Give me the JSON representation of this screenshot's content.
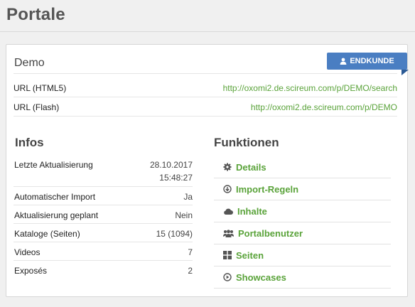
{
  "page": {
    "title": "Portale"
  },
  "card": {
    "title": "Demo",
    "badge": {
      "label": "ENDKUNDE",
      "icon": "user-icon"
    },
    "urls": [
      {
        "label": "URL (HTML5)",
        "value": "http://oxomi2.de.scireum.com/p/DEMO/search"
      },
      {
        "label": "URL (Flash)",
        "value": "http://oxomi2.de.scireum.com/p/DEMO"
      }
    ]
  },
  "infos": {
    "title": "Infos",
    "rows": [
      {
        "label": "Letzte Aktualisierung",
        "value_line1": "28.10.2017",
        "value_line2": "15:48:27"
      },
      {
        "label": "Automatischer Import",
        "value": "Ja"
      },
      {
        "label": "Aktualisierung geplant",
        "value": "Nein"
      },
      {
        "label": "Kataloge (Seiten)",
        "value": "15 (1094)"
      },
      {
        "label": "Videos",
        "value": "7"
      },
      {
        "label": "Exposés",
        "value": "2"
      }
    ]
  },
  "funktionen": {
    "title": "Funktionen",
    "items": [
      {
        "label": "Details",
        "icon": "gear-icon"
      },
      {
        "label": "Import-Regeln",
        "icon": "download-icon"
      },
      {
        "label": "Inhalte",
        "icon": "cloud-icon"
      },
      {
        "label": "Portalbenutzer",
        "icon": "users-icon"
      },
      {
        "label": "Seiten",
        "icon": "grid-icon"
      },
      {
        "label": "Showcases",
        "icon": "play-icon"
      }
    ]
  },
  "colors": {
    "link": "#5aa33a",
    "badge": "#4a7ec2"
  }
}
